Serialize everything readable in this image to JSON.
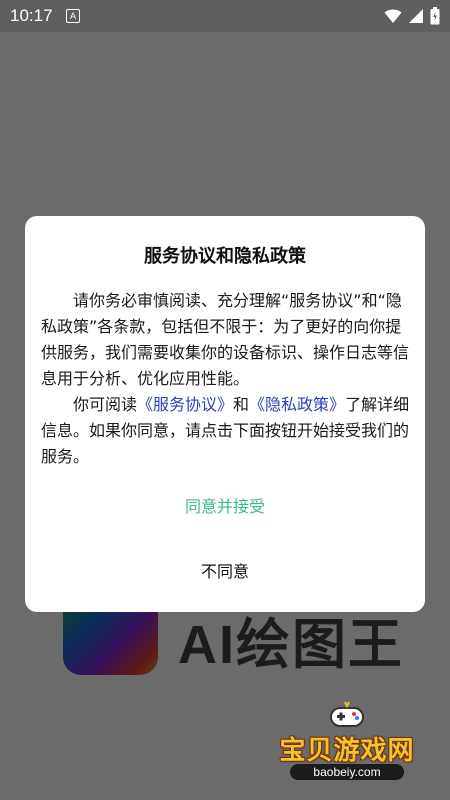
{
  "status_bar": {
    "time": "10:17",
    "notification_glyph": "A",
    "icons": [
      "wifi-icon",
      "signal-icon",
      "battery-icon"
    ]
  },
  "background_app": {
    "logo": "app-logo",
    "name_partial": "AI绘图王"
  },
  "dialog": {
    "title": "服务协议和隐私政策",
    "paragraph1": "请你务必审慎阅读、充分理解“服务协议”和“隐私政策”各条款，包括但不限于：为了更好的向你提供服务，我们需要收集你的设备标识、操作日志等信息用于分析、优化应用性能。",
    "p2_prefix": "你可阅读",
    "service_link": "《服务协议》",
    "and_word": "和",
    "privacy_link": "《隐私政策》",
    "p2_suffix": "了解详细信息。如果你同意，请点击下面按钮开始接受我们的服务。",
    "agree_button": "同意并接受",
    "disagree_button": "不同意",
    "colors": {
      "link": "#2c41b8",
      "agree": "#3fb68e",
      "overlay": "#6b6b6b"
    }
  },
  "watermark": {
    "text": "宝贝游戏网",
    "url": "baobeiy.com"
  }
}
